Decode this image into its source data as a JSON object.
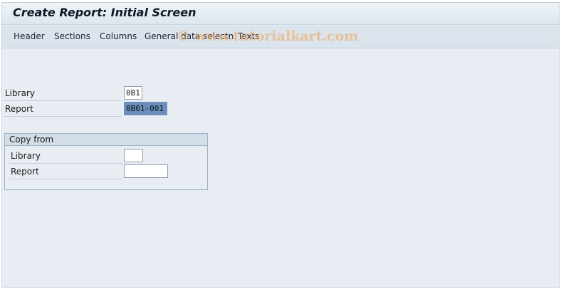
{
  "window": {
    "title": "Create Report: Initial Screen"
  },
  "menu": [
    "Header",
    "Sections",
    "Columns",
    "General data selectn",
    "Texts"
  ],
  "watermark": "© www.tutorialkart.com",
  "main": {
    "library": {
      "label": "Library",
      "value": "0B1"
    },
    "report": {
      "label": "Report",
      "value": "0B01-001"
    }
  },
  "copy_from": {
    "title": "Copy from",
    "library": {
      "label": "Library",
      "value": ""
    },
    "report": {
      "label": "Report",
      "value": ""
    }
  }
}
